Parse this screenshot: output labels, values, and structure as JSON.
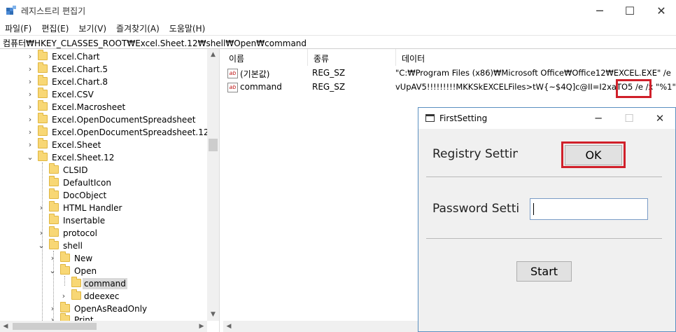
{
  "window": {
    "title": "레지스트리 편집기",
    "minimize_glyph": "─",
    "maximize_glyph": "☐",
    "close_glyph": "✕"
  },
  "menu": [
    "파일(F)",
    "편집(E)",
    "보기(V)",
    "즐겨찾기(A)",
    "도움말(H)"
  ],
  "address": "컴퓨터₩HKEY_CLASSES_ROOT₩Excel.Sheet.12₩shell₩Open₩command",
  "tree": {
    "items": [
      {
        "label": "Excel.Chart",
        "expander": "›"
      },
      {
        "label": "Excel.Chart.5",
        "expander": "›"
      },
      {
        "label": "Excel.Chart.8",
        "expander": "›"
      },
      {
        "label": "Excel.CSV",
        "expander": "›"
      },
      {
        "label": "Excel.Macrosheet",
        "expander": "›"
      },
      {
        "label": "Excel.OpenDocumentSpreadsheet",
        "expander": "›"
      },
      {
        "label": "Excel.OpenDocumentSpreadsheet.12",
        "expander": "›"
      },
      {
        "label": "Excel.Sheet",
        "expander": "›"
      },
      {
        "label": "Excel.Sheet.12",
        "expander": "⌄"
      },
      {
        "label": "CLSID",
        "expander": ""
      },
      {
        "label": "DefaultIcon",
        "expander": ""
      },
      {
        "label": "DocObject",
        "expander": ""
      },
      {
        "label": "HTML Handler",
        "expander": "›"
      },
      {
        "label": "Insertable",
        "expander": ""
      },
      {
        "label": "protocol",
        "expander": "›"
      },
      {
        "label": "shell",
        "expander": "⌄"
      },
      {
        "label": "New",
        "expander": "›"
      },
      {
        "label": "Open",
        "expander": "⌄"
      },
      {
        "label": "command",
        "expander": ""
      },
      {
        "label": "ddeexec",
        "expander": "›"
      },
      {
        "label": "OpenAsReadOnly",
        "expander": "›"
      },
      {
        "label": "Print",
        "expander": "›"
      }
    ],
    "selected": "command"
  },
  "list": {
    "headers": [
      "이름",
      "종류",
      "데이터"
    ],
    "rows": [
      {
        "name": "(기본값)",
        "type": "REG_SZ",
        "data": "\"C:₩Program Files (x86)₩Microsoft Office₩Office12₩EXCEL.EXE\" /e"
      },
      {
        "name": "command",
        "type": "REG_SZ",
        "data": "vUpAV5!!!!!!!!!MKKSkEXCELFiles>tW{~$4Q]c@II=I2xaTO5 /e /x \"%1\""
      }
    ],
    "icon_text": "ab"
  },
  "dialog": {
    "title": "FirstSetting",
    "minimize_glyph": "─",
    "maximize_glyph": "☐",
    "close_glyph": "✕",
    "registry_label": "Registry Setting",
    "ok_label": "OK",
    "password_label": "Password Setti",
    "password_value": "",
    "start_label": "Start"
  },
  "scroll": {
    "up": "▲",
    "down": "▼",
    "left": "◀",
    "right": "▶"
  },
  "colors": {
    "highlight": "#d0202a",
    "folder": "#f8d775",
    "dialog_border": "#5a8fc0"
  }
}
